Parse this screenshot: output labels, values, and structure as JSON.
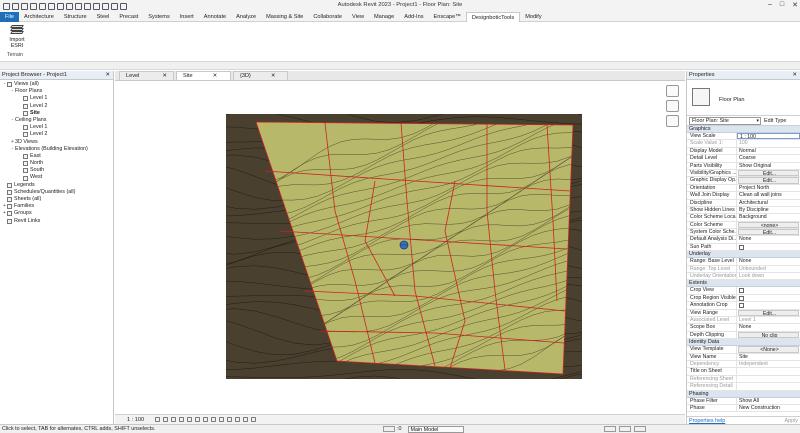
{
  "app": {
    "title": "Autodesk Revit 2023 - Project1 - Floor Plan: Site"
  },
  "ribbon": {
    "tabs": [
      "File",
      "Architecture",
      "Structure",
      "Steel",
      "Precast",
      "Systems",
      "Insert",
      "Annotate",
      "Analyze",
      "Massing & Site",
      "Collaborate",
      "View",
      "Manage",
      "Add-Ins",
      "Enscape™",
      "DesignboticTools",
      "Modify"
    ],
    "active_tab": "DesignboticTools",
    "import_button": "Import ESRI",
    "panel_name": "Terrain"
  },
  "project_browser": {
    "title": "Project Browser - Project1",
    "items": [
      {
        "label": "Views (all)",
        "level": 0,
        "toggle": "-",
        "icon": "views-icon"
      },
      {
        "label": "Floor Plans",
        "level": 1,
        "toggle": "-",
        "icon": ""
      },
      {
        "label": "Level 1",
        "level": 2,
        "toggle": "",
        "icon": "view-icon"
      },
      {
        "label": "Level 2",
        "level": 2,
        "toggle": "",
        "icon": "view-icon"
      },
      {
        "label": "Site",
        "level": 2,
        "toggle": "",
        "icon": "view-icon",
        "selected": true
      },
      {
        "label": "Ceiling Plans",
        "level": 1,
        "toggle": "-",
        "icon": ""
      },
      {
        "label": "Level 1",
        "level": 2,
        "toggle": "",
        "icon": "view-icon"
      },
      {
        "label": "Level 2",
        "level": 2,
        "toggle": "",
        "icon": "view-icon"
      },
      {
        "label": "3D Views",
        "level": 1,
        "toggle": "+",
        "icon": ""
      },
      {
        "label": "Elevations (Building Elevation)",
        "level": 1,
        "toggle": "-",
        "icon": ""
      },
      {
        "label": "East",
        "level": 2,
        "toggle": "",
        "icon": "view-icon"
      },
      {
        "label": "North",
        "level": 2,
        "toggle": "",
        "icon": "view-icon"
      },
      {
        "label": "South",
        "level": 2,
        "toggle": "",
        "icon": "view-icon"
      },
      {
        "label": "West",
        "level": 2,
        "toggle": "",
        "icon": "view-icon"
      },
      {
        "label": "Legends",
        "level": 0,
        "toggle": "",
        "icon": "legend-icon"
      },
      {
        "label": "Schedules/Quantities (all)",
        "level": 0,
        "toggle": "",
        "icon": "schedule-icon"
      },
      {
        "label": "Sheets (all)",
        "level": 0,
        "toggle": "",
        "icon": "sheet-icon"
      },
      {
        "label": "Families",
        "level": 0,
        "toggle": "+",
        "icon": "family-icon"
      },
      {
        "label": "Groups",
        "level": 0,
        "toggle": "+",
        "icon": "group-icon"
      },
      {
        "label": "Revit Links",
        "level": 0,
        "toggle": "",
        "icon": "link-icon"
      }
    ]
  },
  "view_tabs": [
    {
      "label": "Level 1",
      "active": false
    },
    {
      "label": "Site",
      "active": true
    },
    {
      "label": "{3D}",
      "active": false
    }
  ],
  "view_control": {
    "scale": "1 : 100"
  },
  "properties": {
    "title": "Properties",
    "type_name": "Floor Plan",
    "filter": "Floor Plan: Site",
    "edit_type": "Edit Type",
    "sections": [
      {
        "name": "Graphics",
        "rows": [
          {
            "n": "View Scale",
            "v": "1 : 100",
            "kind": "input"
          },
          {
            "n": "Scale Value    1:",
            "v": "100",
            "kind": "dis"
          },
          {
            "n": "Display Model",
            "v": "Normal"
          },
          {
            "n": "Detail Level",
            "v": "Coarse"
          },
          {
            "n": "Parts Visibility",
            "v": "Show Original"
          },
          {
            "n": "Visibility/Graphics ...",
            "v": "Edit...",
            "kind": "btn"
          },
          {
            "n": "Graphic Display Op...",
            "v": "Edit...",
            "kind": "btn"
          },
          {
            "n": "Orientation",
            "v": "Project North"
          },
          {
            "n": "Wall Join Display",
            "v": "Clean all wall joins"
          },
          {
            "n": "Discipline",
            "v": "Architectural"
          },
          {
            "n": "Show Hidden Lines",
            "v": "By Discipline"
          },
          {
            "n": "Color Scheme Loca...",
            "v": "Background"
          },
          {
            "n": "Color Scheme",
            "v": "<none>",
            "kind": "btn"
          },
          {
            "n": "System Color Sche...",
            "v": "Edit...",
            "kind": "btn"
          },
          {
            "n": "Default Analysis Di...",
            "v": "None"
          },
          {
            "n": "Sun Path",
            "v": "",
            "kind": "cb"
          }
        ]
      },
      {
        "name": "Underlay",
        "rows": [
          {
            "n": "Range: Base Level",
            "v": "None"
          },
          {
            "n": "Range: Top Level",
            "v": "Unbounded",
            "kind": "dis"
          },
          {
            "n": "Underlay Orientation",
            "v": "Look down",
            "kind": "dis"
          }
        ]
      },
      {
        "name": "Extents",
        "rows": [
          {
            "n": "Crop View",
            "v": "",
            "kind": "cb"
          },
          {
            "n": "Crop Region Visible",
            "v": "",
            "kind": "cb"
          },
          {
            "n": "Annotation Crop",
            "v": "",
            "kind": "cb"
          },
          {
            "n": "View Range",
            "v": "Edit...",
            "kind": "btn"
          },
          {
            "n": "Associated Level",
            "v": "Level 1",
            "kind": "dis"
          },
          {
            "n": "Scope Box",
            "v": "None"
          },
          {
            "n": "Depth Clipping",
            "v": "No clip",
            "kind": "btn"
          }
        ]
      },
      {
        "name": "Identity Data",
        "rows": [
          {
            "n": "View Template",
            "v": "<None>",
            "kind": "btn"
          },
          {
            "n": "View Name",
            "v": "Site"
          },
          {
            "n": "Dependency",
            "v": "Independent",
            "kind": "dis"
          },
          {
            "n": "Title on Sheet",
            "v": ""
          },
          {
            "n": "Referencing Sheet",
            "v": "",
            "kind": "dis"
          },
          {
            "n": "Referencing Detail",
            "v": "",
            "kind": "dis"
          }
        ]
      },
      {
        "name": "Phasing",
        "rows": [
          {
            "n": "Phase Filter",
            "v": "Show All"
          },
          {
            "n": "Phase",
            "v": "New Construction"
          }
        ]
      }
    ],
    "help": "Properties help",
    "apply": "Apply"
  },
  "status": {
    "message": "Click to select, TAB for alternates, CTRL adds, SHIFT unselects.",
    "model": "Main Model",
    "zero": ":0"
  },
  "colors": {
    "accent": "#1e6fb8",
    "terrain": "#b8b86a",
    "terrain_dark": "#4a4030",
    "grid_line": "#cc2222"
  }
}
